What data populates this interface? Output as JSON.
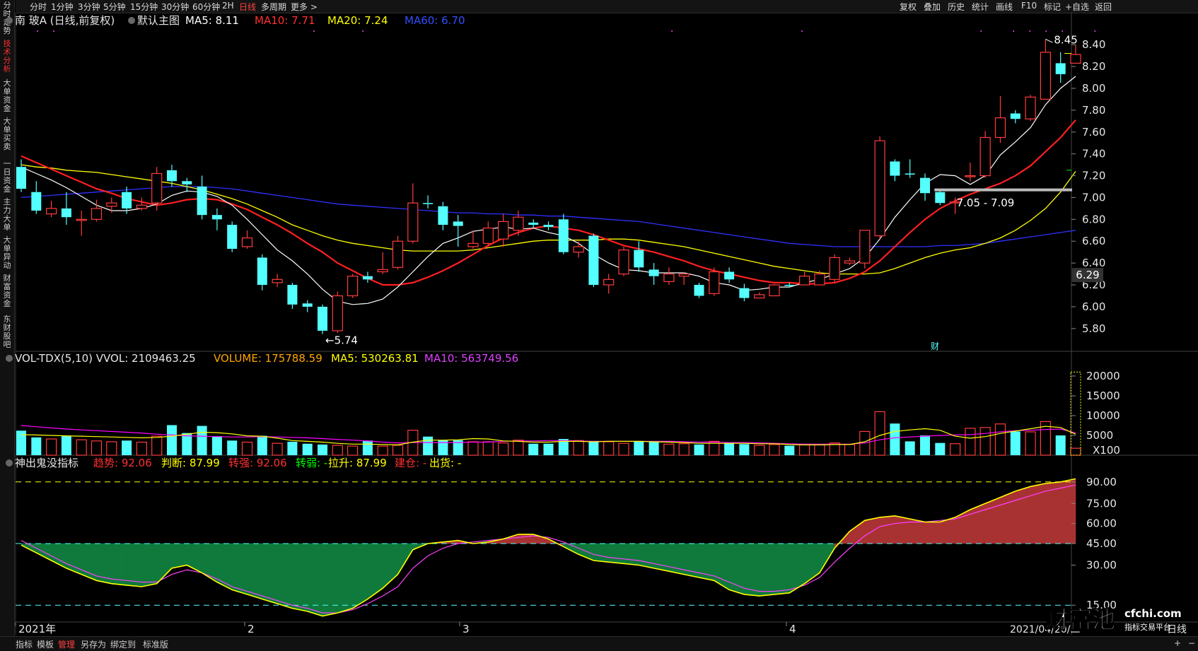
{
  "topbar": {
    "left_items": [
      "分时",
      "1分钟",
      "3分钟",
      "5分钟",
      "15分钟",
      "30分钟",
      "60分钟",
      "2H",
      "日线",
      "多周期",
      "更多 >"
    ],
    "active": "日线",
    "right_items": [
      "复权",
      "叠加",
      "历史",
      "统计",
      "画线",
      "F10",
      "标记",
      "+自选",
      "返回"
    ]
  },
  "sidebar": {
    "tabs": [
      "分时走势",
      "技术分析",
      "大单资金",
      "大单买卖",
      "一日资金",
      "主力大单",
      "大单异动",
      "财富资金",
      "东财股吧"
    ],
    "active": "技术分析"
  },
  "main_legend": {
    "stock": "南 玻A (日线,前复权)",
    "template": "默认主图",
    "ma5": "MA5: 8.11",
    "ma10": "MA10: 7.71",
    "ma20": "MA20: 7.24",
    "ma60": "MA60: 6.70"
  },
  "vol_legend": {
    "name": "VOL-TDX(5,10) VVOL: 2109463.25",
    "volume": "VOLUME: 175788.59",
    "ma5": "MA5: 530263.81",
    "ma10": "MA10: 563749.56"
  },
  "ind_legend": {
    "name": "神出鬼没指标",
    "trend": "趋势: 92.06",
    "judge": "判断: 87.99",
    "strong": "转强: 92.06",
    "weak": "转弱: -",
    "rise": "拉升: 87.99",
    "build": "建仓: -",
    "out": "出货: -"
  },
  "annotations": {
    "high": "8.45",
    "low": "5.74",
    "range": "7.05 - 7.09",
    "finance_mark": "财",
    "price_tag": "6.29",
    "date_label": "2021/04/20/二",
    "vol_unit": "X100",
    "period": "日线"
  },
  "x_axis": {
    "labels": [
      "2021年",
      "2",
      "3",
      "4"
    ]
  },
  "price_axis": [
    "8.40",
    "8.20",
    "8.00",
    "7.80",
    "7.60",
    "7.40",
    "7.20",
    "7.00",
    "6.80",
    "6.60",
    "6.40",
    "6.20",
    "6.00",
    "5.80"
  ],
  "vol_axis": [
    "20000",
    "15000",
    "10000",
    "5000"
  ],
  "ind_axis": [
    "90.00",
    "75.00",
    "60.00",
    "45.00",
    "30.00",
    "15.00"
  ],
  "bottombar": {
    "buttons": [
      "指标",
      "模板",
      "管理",
      "另存为",
      "绑定到",
      "标准版"
    ],
    "active": "管理"
  },
  "watermark": {
    "brand": "财富池",
    "site": "cfchi.com",
    "slogan": "指标交易平台"
  },
  "colors": {
    "up": "#ff3b3b",
    "down": "#54ffff",
    "ma5": "#ffffff",
    "ma10": "#ff2020",
    "ma20": "#ffff00",
    "ma60": "#3030ff",
    "vol_ma10": "#ff00ff"
  },
  "chart_data": {
    "type": "candlestick",
    "title": "南 玻A (日线,前复权)",
    "ylim": [
      5.65,
      8.55
    ],
    "candles": [
      [
        7.28,
        7.08,
        7.35,
        7.05
      ],
      [
        7.05,
        6.88,
        7.15,
        6.85
      ],
      [
        6.85,
        6.9,
        6.97,
        6.82
      ],
      [
        6.9,
        6.82,
        7.05,
        6.75
      ],
      [
        6.8,
        6.8,
        6.88,
        6.65
      ],
      [
        6.8,
        6.9,
        6.98,
        6.78
      ],
      [
        6.92,
        6.95,
        7.0,
        6.86
      ],
      [
        7.05,
        6.9,
        7.1,
        6.85
      ],
      [
        6.9,
        6.93,
        7.0,
        6.88
      ],
      [
        6.95,
        7.22,
        7.28,
        6.88
      ],
      [
        7.25,
        7.15,
        7.3,
        7.1
      ],
      [
        7.15,
        7.12,
        7.18,
        7.05
      ],
      [
        7.1,
        6.84,
        7.2,
        6.8
      ],
      [
        6.84,
        6.8,
        6.9,
        6.7
      ],
      [
        6.75,
        6.53,
        6.78,
        6.5
      ],
      [
        6.55,
        6.63,
        6.7,
        6.53
      ],
      [
        6.45,
        6.2,
        6.48,
        6.15
      ],
      [
        6.22,
        6.25,
        6.3,
        6.18
      ],
      [
        6.2,
        6.02,
        6.22,
        5.98
      ],
      [
        6.03,
        6.0,
        6.06,
        5.95
      ],
      [
        6.0,
        5.78,
        6.02,
        5.75
      ],
      [
        5.78,
        6.1,
        6.14,
        5.76
      ],
      [
        6.1,
        6.28,
        6.3,
        6.08
      ],
      [
        6.28,
        6.25,
        6.32,
        6.22
      ],
      [
        6.32,
        6.34,
        6.5,
        6.3
      ],
      [
        6.36,
        6.6,
        6.65,
        6.34
      ],
      [
        6.6,
        6.95,
        7.13,
        6.58
      ],
      [
        6.95,
        6.94,
        7.02,
        6.9
      ],
      [
        6.92,
        6.75,
        6.96,
        6.7
      ],
      [
        6.78,
        6.74,
        6.84,
        6.55
      ],
      [
        6.55,
        6.58,
        6.7,
        6.53
      ],
      [
        6.58,
        6.72,
        6.78,
        6.55
      ],
      [
        6.62,
        6.78,
        6.85,
        6.55
      ],
      [
        6.7,
        6.82,
        6.88,
        6.65
      ],
      [
        6.77,
        6.75,
        6.8,
        6.72
      ],
      [
        6.75,
        6.73,
        6.78,
        6.7
      ],
      [
        6.8,
        6.5,
        6.85,
        6.48
      ],
      [
        6.5,
        6.55,
        6.6,
        6.45
      ],
      [
        6.65,
        6.2,
        6.67,
        6.18
      ],
      [
        6.2,
        6.25,
        6.3,
        6.12
      ],
      [
        6.3,
        6.52,
        6.55,
        6.28
      ],
      [
        6.52,
        6.36,
        6.6,
        6.32
      ],
      [
        6.34,
        6.28,
        6.4,
        6.2
      ],
      [
        6.23,
        6.3,
        6.36,
        6.2
      ],
      [
        6.28,
        6.3,
        6.31,
        6.2
      ],
      [
        6.2,
        6.1,
        6.22,
        6.08
      ],
      [
        6.12,
        6.32,
        6.36,
        6.1
      ],
      [
        6.32,
        6.25,
        6.36,
        6.22
      ],
      [
        6.17,
        6.08,
        6.21,
        6.05
      ],
      [
        6.08,
        6.11,
        6.13,
        6.08
      ],
      [
        6.1,
        6.2,
        6.21,
        6.1
      ],
      [
        6.2,
        6.19,
        6.22,
        6.18
      ],
      [
        6.2,
        6.28,
        6.32,
        6.2
      ],
      [
        6.2,
        6.3,
        6.33,
        6.2
      ],
      [
        6.25,
        6.45,
        6.48,
        6.22
      ],
      [
        6.4,
        6.42,
        6.45,
        6.38
      ],
      [
        6.4,
        6.7,
        6.7,
        6.35
      ],
      [
        6.65,
        7.52,
        7.56,
        6.62
      ],
      [
        7.33,
        7.2,
        7.35,
        7.15
      ],
      [
        7.22,
        7.21,
        7.35,
        7.18
      ],
      [
        7.18,
        7.04,
        7.22,
        6.97
      ],
      [
        7.05,
        6.95,
        7.06,
        6.93
      ],
      [
        6.96,
        6.96,
        7.0,
        6.85
      ],
      [
        7.2,
        7.2,
        7.32,
        7.15
      ],
      [
        7.2,
        7.55,
        7.61,
        7.18
      ],
      [
        7.55,
        7.73,
        7.93,
        7.5
      ],
      [
        7.77,
        7.72,
        7.8,
        7.68
      ],
      [
        7.72,
        7.92,
        7.94,
        7.7
      ],
      [
        7.9,
        8.33,
        8.45,
        7.9
      ],
      [
        8.23,
        8.13,
        8.33,
        8.05
      ],
      [
        8.23,
        8.31,
        8.4,
        8.23
      ]
    ],
    "ma5": [
      7.28,
      7.22,
      7.16,
      7.09,
      7.01,
      6.93,
      6.88,
      6.88,
      6.9,
      6.94,
      7.02,
      7.06,
      7.05,
      7.01,
      6.93,
      6.8,
      6.66,
      6.52,
      6.42,
      6.3,
      6.16,
      6.05,
      6.02,
      6.03,
      6.07,
      6.18,
      6.32,
      6.46,
      6.58,
      6.63,
      6.69,
      6.71,
      6.73,
      6.71,
      6.72,
      6.68,
      6.65,
      6.58,
      6.48,
      6.4,
      6.34,
      6.33,
      6.31,
      6.31,
      6.31,
      6.28,
      6.22,
      6.2,
      6.15,
      6.16,
      6.18,
      6.18,
      6.22,
      6.25,
      6.3,
      6.35,
      6.45,
      6.62,
      6.82,
      6.98,
      7.13,
      7.21,
      7.2,
      7.12,
      7.2,
      7.39,
      7.51,
      7.64,
      7.85,
      8.0,
      8.11
    ],
    "ma10": [
      7.38,
      7.32,
      7.26,
      7.2,
      7.14,
      7.08,
      7.04,
      6.99,
      6.96,
      6.93,
      6.95,
      6.98,
      6.99,
      6.98,
      6.94,
      6.89,
      6.82,
      6.75,
      6.67,
      6.58,
      6.5,
      6.4,
      6.33,
      6.26,
      6.2,
      6.2,
      6.22,
      6.27,
      6.33,
      6.4,
      6.48,
      6.56,
      6.63,
      6.68,
      6.72,
      6.74,
      6.72,
      6.7,
      6.66,
      6.61,
      6.56,
      6.53,
      6.5,
      6.46,
      6.42,
      6.37,
      6.33,
      6.3,
      6.27,
      6.24,
      6.22,
      6.22,
      6.21,
      6.21,
      6.22,
      6.26,
      6.32,
      6.42,
      6.55,
      6.68,
      6.8,
      6.9,
      6.97,
      7.03,
      7.08,
      7.13,
      7.2,
      7.29,
      7.42,
      7.55,
      7.71
    ],
    "ma20": [
      7.3,
      7.28,
      7.27,
      7.25,
      7.24,
      7.23,
      7.21,
      7.19,
      7.17,
      7.15,
      7.13,
      7.1,
      7.07,
      7.03,
      6.99,
      6.94,
      6.88,
      6.82,
      6.75,
      6.7,
      6.65,
      6.61,
      6.58,
      6.56,
      6.54,
      6.52,
      6.51,
      6.51,
      6.51,
      6.51,
      6.52,
      6.54,
      6.56,
      6.58,
      6.6,
      6.61,
      6.61,
      6.61,
      6.61,
      6.62,
      6.62,
      6.61,
      6.59,
      6.57,
      6.55,
      6.52,
      6.49,
      6.46,
      6.43,
      6.4,
      6.37,
      6.35,
      6.33,
      6.31,
      6.3,
      6.3,
      6.3,
      6.31,
      6.35,
      6.4,
      6.45,
      6.49,
      6.52,
      6.54,
      6.58,
      6.63,
      6.7,
      6.79,
      6.9,
      7.05,
      7.24
    ],
    "ma60": [
      7.0,
      7.01,
      7.02,
      7.03,
      7.04,
      7.05,
      7.06,
      7.07,
      7.08,
      7.09,
      7.1,
      7.1,
      7.1,
      7.09,
      7.08,
      7.06,
      7.04,
      7.02,
      7.0,
      6.98,
      6.96,
      6.94,
      6.93,
      6.92,
      6.91,
      6.9,
      6.89,
      6.88,
      6.87,
      6.86,
      6.86,
      6.85,
      6.85,
      6.84,
      6.84,
      6.83,
      6.83,
      6.82,
      6.81,
      6.8,
      6.79,
      6.78,
      6.76,
      6.74,
      6.72,
      6.7,
      6.68,
      6.66,
      6.64,
      6.62,
      6.6,
      6.58,
      6.57,
      6.56,
      6.55,
      6.55,
      6.55,
      6.55,
      6.55,
      6.55,
      6.55,
      6.56,
      6.56,
      6.57,
      6.58,
      6.6,
      6.62,
      6.64,
      6.66,
      6.68,
      6.7
    ],
    "volume": [
      6200,
      4500,
      4100,
      4800,
      3900,
      3600,
      3400,
      3700,
      3300,
      4800,
      7600,
      5600,
      7400,
      4800,
      3700,
      3300,
      4900,
      3000,
      3400,
      2900,
      2700,
      2500,
      2300,
      3700,
      2300,
      2500,
      6300,
      4700,
      3800,
      3800,
      3400,
      3400,
      3100,
      3800,
      2900,
      2900,
      4100,
      3700,
      3600,
      3400,
      3000,
      3600,
      3300,
      2800,
      2900,
      2700,
      3500,
      3100,
      2800,
      2500,
      2700,
      2400,
      2600,
      2600,
      3100,
      2700,
      6000,
      11000,
      8000,
      3500,
      5000,
      3100,
      2900,
      6800,
      7000,
      7900,
      6000,
      5900,
      8500,
      5000,
      1758
    ],
    "vol_ma5": [
      5200,
      5100,
      5000,
      4900,
      4800,
      4700,
      4600,
      4500,
      4400,
      4500,
      4800,
      5300,
      5800,
      5700,
      5400,
      4900,
      4800,
      4300,
      3700,
      3500,
      3300,
      3000,
      2800,
      2800,
      2700,
      2600,
      3300,
      3800,
      3800,
      3900,
      4200,
      4100,
      3600,
      3500,
      3300,
      3300,
      3500,
      3500,
      3400,
      3500,
      3500,
      3500,
      3400,
      3300,
      3200,
      3000,
      3000,
      3000,
      3000,
      2900,
      2900,
      2700,
      2600,
      2600,
      2700,
      2700,
      3400,
      5000,
      6000,
      6400,
      6700,
      6300,
      4800,
      4300,
      4700,
      5500,
      6100,
      6700,
      7300,
      7000,
      5302
    ],
    "vol_ma10": [
      7500,
      7200,
      6900,
      6600,
      6400,
      6200,
      6000,
      5800,
      5600,
      5300,
      5100,
      4900,
      4800,
      4700,
      4600,
      4600,
      4700,
      4600,
      4500,
      4400,
      4200,
      4000,
      3800,
      3600,
      3300,
      3100,
      3200,
      3200,
      3200,
      3200,
      3300,
      3300,
      3500,
      3600,
      3600,
      3700,
      3700,
      3600,
      3500,
      3500,
      3500,
      3500,
      3500,
      3500,
      3400,
      3300,
      3300,
      3200,
      3200,
      3100,
      3000,
      2900,
      2800,
      2800,
      2800,
      2800,
      3100,
      3900,
      4400,
      4600,
      4800,
      5000,
      5100,
      5200,
      5500,
      5900,
      6200,
      6300,
      6500,
      6600,
      5637
    ],
    "trend": [
      49,
      44,
      39,
      34,
      30,
      26,
      24,
      23,
      22,
      24,
      34,
      36,
      31,
      25,
      20,
      17,
      14,
      11,
      8,
      6,
      3,
      5,
      8,
      14,
      21,
      30,
      46,
      50,
      51,
      52,
      50,
      51,
      53,
      56,
      56,
      53,
      48,
      43,
      39,
      38,
      37,
      36,
      34,
      32,
      30,
      28,
      26,
      20,
      17,
      16,
      17,
      18,
      24,
      31,
      47,
      58,
      65,
      67,
      68,
      66,
      64,
      64,
      67,
      72,
      76,
      80,
      84,
      87,
      89,
      90,
      92
    ],
    "judge": [
      52,
      47,
      42,
      37,
      33,
      29,
      27,
      26,
      25,
      25,
      30,
      33,
      31,
      27,
      22,
      19,
      16,
      13,
      10,
      8,
      5,
      5,
      7,
      11,
      16,
      22,
      34,
      42,
      47,
      50,
      51,
      52,
      53,
      54,
      55,
      54,
      51,
      47,
      43,
      41,
      40,
      39,
      37,
      35,
      33,
      31,
      29,
      25,
      21,
      19,
      19,
      20,
      23,
      28,
      38,
      47,
      55,
      61,
      63,
      64,
      64,
      65,
      66,
      69,
      72,
      75,
      78,
      81,
      84,
      86,
      88
    ]
  }
}
